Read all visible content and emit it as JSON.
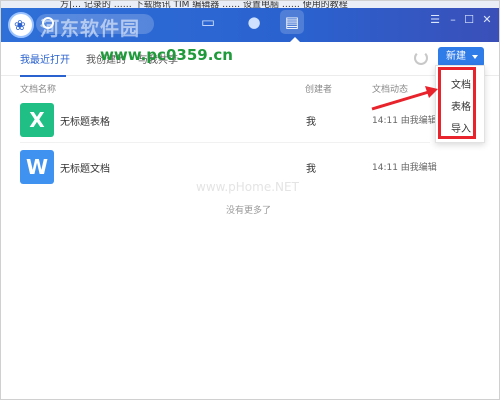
{
  "top_strip_text": "方|… 记录的 …… 下载腾讯 TIM 编辑器 …… 设置电脑 …… 使用的教程",
  "watermark_top": "河东软件园",
  "watermark_url": "www.pc0359.cn",
  "watermark_center": "www.pHome.NET",
  "window_controls": {
    "menu": "☰",
    "minimize": "–",
    "maximize": "☐",
    "close": "✕"
  },
  "nav": {
    "chat_icon": "chat-bubble",
    "contacts_icon": "person",
    "docs_icon": "document"
  },
  "tabs": [
    {
      "label": "我最近打开"
    },
    {
      "label": "我创建的"
    },
    {
      "label": "与我共享"
    }
  ],
  "toolbar": {
    "new_label": "新建"
  },
  "columns": {
    "name": "文档名称",
    "creator": "创建者",
    "activity": "文档动态"
  },
  "files": [
    {
      "icon_letter": "X",
      "icon_color": "#1fbf86",
      "name": "无标题表格",
      "creator": "我",
      "activity": "14:11 由我编辑"
    },
    {
      "icon_letter": "W",
      "icon_color": "#3f92f0",
      "name": "无标题文档",
      "creator": "我",
      "activity": "14:11 由我编辑"
    }
  ],
  "empty_text": "没有更多了",
  "dropdown": [
    {
      "label": "文档"
    },
    {
      "label": "表格"
    },
    {
      "label": "导入"
    }
  ],
  "colors": {
    "brand": "#2a62cf",
    "accent_button": "#2f7be8",
    "highlight": "#e8232b"
  }
}
